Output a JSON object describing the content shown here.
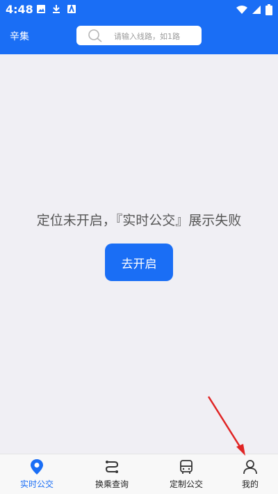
{
  "status_bar": {
    "time": "4:48"
  },
  "header": {
    "city": "辛集",
    "search": {
      "placeholder": "请输入线路，如1路"
    }
  },
  "main": {
    "message": "定位未开启，『实时公交』展示失败",
    "open_button": "去开启"
  },
  "tabbar": {
    "items": [
      {
        "label": "实时公交",
        "icon": "location-pin-icon",
        "active": true
      },
      {
        "label": "换乘查询",
        "icon": "route-icon",
        "active": false
      },
      {
        "label": "定制公交",
        "icon": "bus-icon",
        "active": false
      },
      {
        "label": "我的",
        "icon": "user-icon",
        "active": false
      }
    ]
  },
  "colors": {
    "accent": "#1a6ef5",
    "background": "#f0eff4",
    "arrow": "#e02424"
  }
}
